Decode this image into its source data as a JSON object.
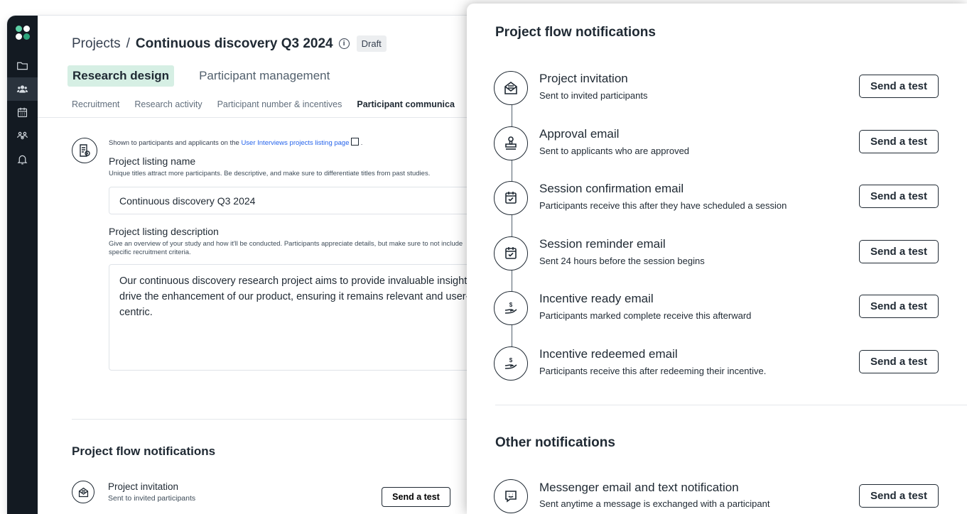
{
  "breadcrumb": {
    "root": "Projects",
    "separator": "/",
    "current": "Continuous discovery Q3 2024",
    "info": "i",
    "status": "Draft"
  },
  "main_tabs": [
    {
      "label": "Research design",
      "active": true
    },
    {
      "label": "Participant management",
      "active": false
    }
  ],
  "sub_tabs": [
    {
      "label": "Recruitment",
      "active": false
    },
    {
      "label": "Research activity",
      "active": false
    },
    {
      "label": "Participant number & incentives",
      "active": false
    },
    {
      "label": "Participant communica",
      "active": true
    }
  ],
  "listing": {
    "shown_prefix": "Shown to participants and applicants on the ",
    "shown_link": "User Interviews projects listing page",
    "shown_suffix": " .",
    "name_label": "Project listing name",
    "name_help": "Unique titles attract more participants. Be descriptive, and make sure to differentiate titles from past studies.",
    "name_value": "Continuous discovery Q3 2024",
    "desc_label": "Project listing description",
    "desc_help": "Give an overview of your study and how it'll be conducted. Participants appreciate details, but make sure to not include specific recruitment criteria.",
    "desc_value": "Our continuous discovery research project aims to provide invaluable insights to drive the enhancement of our product, ensuring it remains relevant and user-centric."
  },
  "back_flow": {
    "title": "Project flow notifications",
    "item_title": "Project invitation",
    "item_desc": "Sent to invited participants",
    "send_label": "Send a test"
  },
  "panel": {
    "flow_title": "Project flow notifications",
    "flow_items": [
      {
        "title": "Project invitation",
        "desc": "Sent to invited participants",
        "send": "Send a test",
        "icon": "envelope-icon"
      },
      {
        "title": "Approval email",
        "desc": "Sent to applicants who are approved",
        "send": "Send a test",
        "icon": "stamp-icon"
      },
      {
        "title": "Session confirmation email",
        "desc": "Participants receive this after they have scheduled a session",
        "send": "Send a test",
        "icon": "calendar-check-icon"
      },
      {
        "title": "Session reminder email",
        "desc": "Sent 24 hours before the session begins",
        "send": "Send a test",
        "icon": "calendar-check-icon"
      },
      {
        "title": "Incentive ready email",
        "desc": "Participants marked complete receive this afterward",
        "send": "Send a test",
        "icon": "money-hand-icon"
      },
      {
        "title": "Incentive redeemed email",
        "desc": "Participants  receive this after redeeming their incentive.",
        "send": "Send a test",
        "icon": "money-hand-icon"
      }
    ],
    "other_title": "Other notifications",
    "other_items": [
      {
        "title": "Messenger email and text notification",
        "desc": "Sent anytime a message is exchanged with a participant",
        "send": "Send a test",
        "icon": "chat-smile-icon"
      }
    ]
  }
}
